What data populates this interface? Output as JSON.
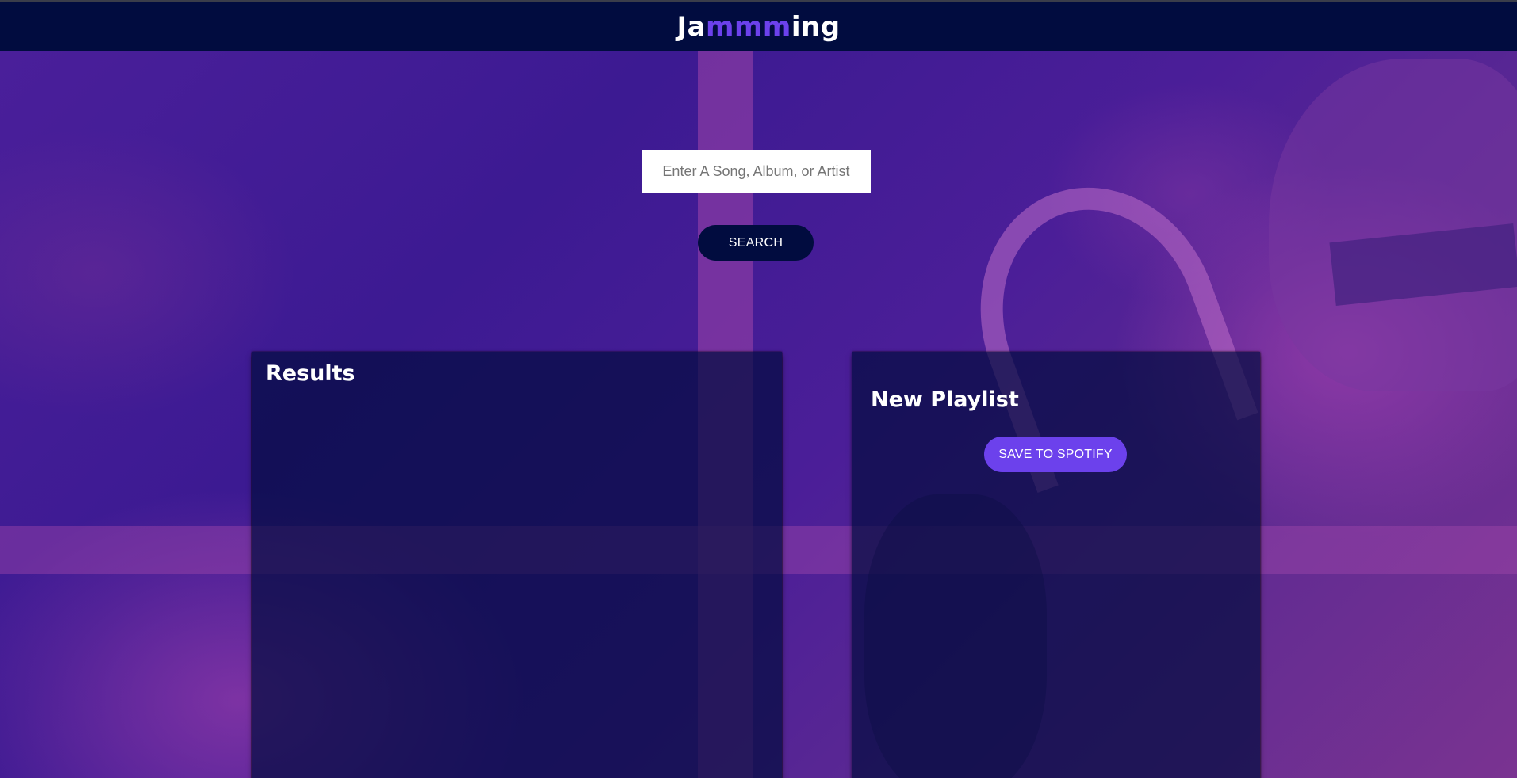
{
  "header": {
    "logo_part1": "Ja",
    "logo_part2": "mmm",
    "logo_part3": "ing",
    "background_color": "#010c3f",
    "accent_color": "#6c41ec"
  },
  "search": {
    "placeholder": "Enter A Song, Album, or Artist",
    "value": "",
    "button_label": "SEARCH"
  },
  "results": {
    "title": "Results",
    "tracks": []
  },
  "playlist": {
    "name": "New Playlist",
    "save_label": "SAVE TO SPOTIFY",
    "tracks": []
  }
}
